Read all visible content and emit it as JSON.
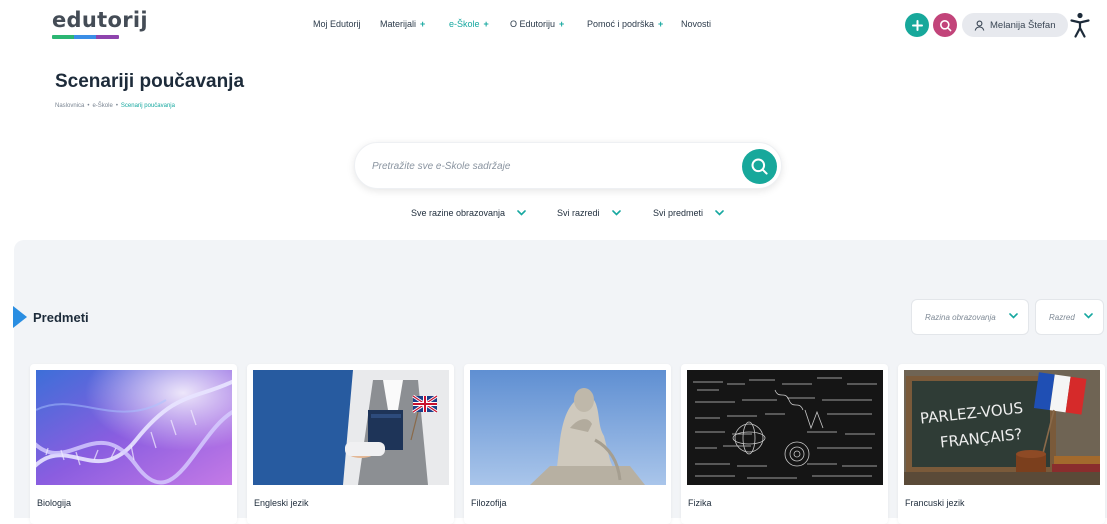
{
  "header": {
    "logo": "edutorij",
    "nav": [
      {
        "label": "Moj Edutorij",
        "plus": ""
      },
      {
        "label": "Materijali",
        "plus": "+"
      },
      {
        "label": "e-Škole",
        "plus": "+"
      },
      {
        "label": "O Edutoriju",
        "plus": "+"
      },
      {
        "label": "Pomoć i podrška",
        "plus": "+"
      },
      {
        "label": "Novosti",
        "plus": ""
      }
    ],
    "add_icon": "plus-icon",
    "search_icon": "search-icon",
    "user_name": "Melanija Štefan",
    "accessibility_icon": "accessibility-icon"
  },
  "page": {
    "title": "Scenariji poučavanja",
    "breadcrumb": [
      "Naslovnica",
      "e-Škole",
      "Scenarij poučavanja"
    ]
  },
  "search": {
    "placeholder": "Pretražite sve e-Škole sadržaje"
  },
  "filters": [
    "Sve razine obrazovanja",
    "Svi razredi",
    "Svi predmeti"
  ],
  "section": {
    "title": "Predmeti",
    "select_level": "Razina obrazovanja",
    "select_grade": "Razred"
  },
  "subjects": [
    {
      "name": "Biologija"
    },
    {
      "name": "Engleski jezik"
    },
    {
      "name": "Filozofija"
    },
    {
      "name": "Fizika"
    },
    {
      "name": "Francuski jezik",
      "board_text_1": "PARLEZ-VOUS",
      "board_text_2": "FRANÇAIS?"
    }
  ],
  "colors": {
    "accent": "#17a89b",
    "search_circle": "#c2447a",
    "section_marker": "#2a8ee2",
    "panel": "#f2f4f7"
  }
}
